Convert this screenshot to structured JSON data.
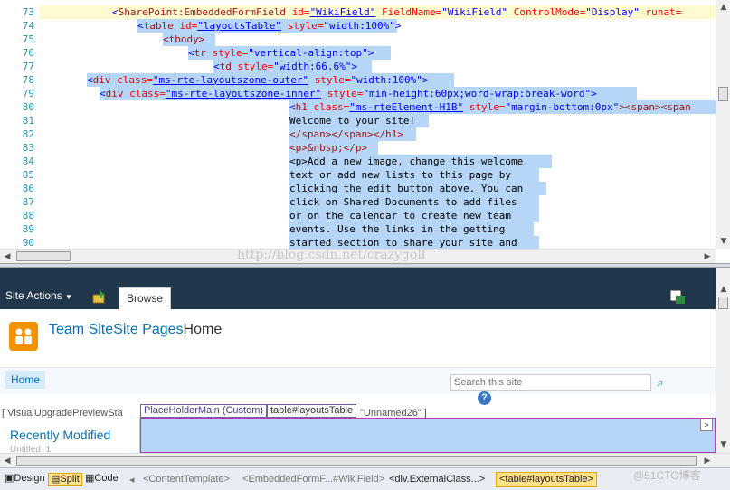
{
  "code_view": {
    "lines": [
      {
        "n": "73"
      },
      {
        "n": "74"
      },
      {
        "n": "75"
      },
      {
        "n": "76"
      },
      {
        "n": "77"
      },
      {
        "n": "78"
      },
      {
        "n": "79"
      },
      {
        "n": "80"
      },
      {
        "n": "81"
      },
      {
        "n": "82"
      },
      {
        "n": "83"
      },
      {
        "n": "84"
      },
      {
        "n": "85"
      },
      {
        "n": "86"
      },
      {
        "n": "87"
      },
      {
        "n": "88"
      },
      {
        "n": "89"
      },
      {
        "n": "90"
      }
    ],
    "l73": {
      "lt": "<",
      "tag": "SharePoint:EmbeddedFormField",
      "a1": "id=",
      "v1": "\"WikiField\"",
      "a2": "FieldName=",
      "v2": "\"WikiField\"",
      "a3": "ControlMode=",
      "v3": "\"Display\"",
      "a4": "runat="
    },
    "l74": {
      "lt": "<",
      "tag": "table",
      "a1": "id=",
      "v1": "\"layoutsTable\"",
      "a2": "style=",
      "v2": "\"width:100%\"",
      "gt": ">"
    },
    "l75": {
      "text": "<tbody>"
    },
    "l76": {
      "lt": "<",
      "tag": "tr",
      "a1": "style=",
      "v1": "\"vertical-align:top\"",
      "gt": ">"
    },
    "l77": {
      "lt": "<",
      "tag": "td",
      "a1": "style=",
      "v1": "\"width:66.6%\"",
      "gt": ">"
    },
    "l78": {
      "lt": "<",
      "tag": "div",
      "a1": "class=",
      "v1": "\"ms-rte-layoutszone-outer\"",
      "a2": "style=",
      "v2": "\"width:100%\"",
      "gt": ">"
    },
    "l79": {
      "lt": "<",
      "tag": "div",
      "a1": "class=",
      "v1": "\"ms-rte-layoutszone-inner\"",
      "a2": "style=",
      "v2": "\"min-height:60px;word-wrap:break-word\"",
      "gt": ">"
    },
    "l80": {
      "lt": "<",
      "tag": "h1",
      "a1": "class=",
      "v1": "\"ms-rteElement-H1B\"",
      "a2": "style=",
      "v2": "\"margin-bottom:0px\"",
      "rest": "><span><span"
    },
    "l81": {
      "text": "Welcome to your site!"
    },
    "l82": {
      "text": "</span></span></h1>"
    },
    "l83": {
      "text": "<p>&nbsp;</p>"
    },
    "l84": {
      "text": "<p>Add a new image, change this welcome"
    },
    "l85": {
      "text": "text or add new lists to this page by"
    },
    "l86": {
      "text": "clicking the edit button above. You can"
    },
    "l87": {
      "text": "click on Shared Documents to add files"
    },
    "l88": {
      "text": "or on the calendar to create new team"
    },
    "l89": {
      "text": "events. Use the links in the getting"
    },
    "l90": {
      "text": "started section to share your site and"
    }
  },
  "watermarks": {
    "blog": "http://blog.csdn.net/crazygolf",
    "corner": "@51CTO博客"
  },
  "design_view": {
    "site_actions": "Site Actions",
    "browse_tab": "Browse",
    "site_title_a": "Team Site",
    "site_title_b": "Site Pages",
    "site_title_c": "Home",
    "home_nav": "Home",
    "search_placeholder": "Search this site",
    "help_glyph": "?",
    "visual_upgrade": "[ VisualUpgradePreviewSta",
    "placeholder_tag": "PlaceHolderMain (Custom)",
    "table_tag": "table#layoutsTable",
    "unnamed": "\"Unnamed26\" ]",
    "recently_modified": "Recently Modified",
    "untitled": "Untitled_1"
  },
  "status_bar": {
    "design": "Design",
    "split": "Split",
    "code": "Code",
    "crumb1": "<ContentTemplate>",
    "crumb2": "<EmbeddedFormF...#WikiField>",
    "crumb3": "<div.ExternalClass...>",
    "crumb_selected": "<table#layoutsTable>"
  },
  "colors": {
    "selection": "#b5d6f6",
    "ribbon": "#21374c",
    "link": "#0072bc"
  }
}
